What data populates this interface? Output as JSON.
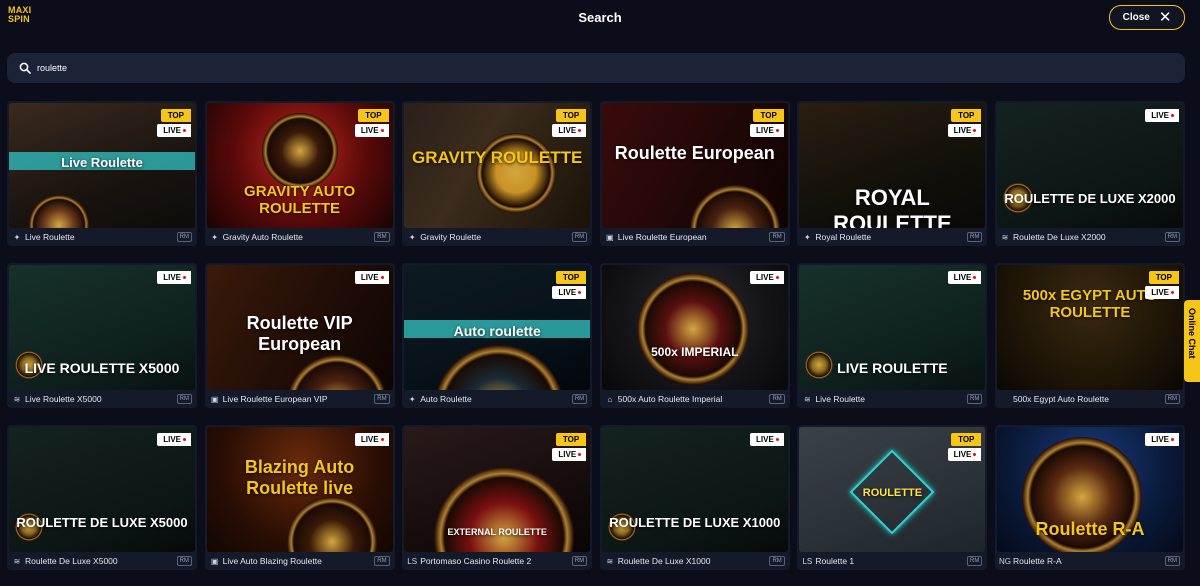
{
  "header": {
    "logo": "MAXI SPIN",
    "title": "Search",
    "close_label": "Close"
  },
  "search": {
    "value": "roulette",
    "icon": "search-icon"
  },
  "chat": {
    "label": "Online Chat"
  },
  "colors": {
    "accent": "#f5c518",
    "background": "#0b0e1a",
    "card": "#151a2b"
  },
  "games": [
    {
      "name": "Live Roulette",
      "thumb_title": "Live Roulette",
      "top": true,
      "live": true,
      "provider_icon": "star-icon",
      "tag": "RM"
    },
    {
      "name": "Gravity Auto Roulette",
      "thumb_title": "GRAVITY AUTO ROULETTE",
      "top": true,
      "live": true,
      "provider_icon": "star-icon",
      "tag": "RM"
    },
    {
      "name": "Gravity Roulette",
      "thumb_title": "GRAVITY ROULETTE",
      "top": true,
      "live": true,
      "provider_icon": "star-icon",
      "tag": "RM"
    },
    {
      "name": "Live Roulette European",
      "thumb_title": "Roulette European",
      "top": true,
      "live": true,
      "provider_icon": "p-icon",
      "tag": "RM"
    },
    {
      "name": "Royal Roulette",
      "thumb_title": "ROYAL ROULETTE",
      "top": true,
      "live": true,
      "provider_icon": "star-icon",
      "tag": "RM"
    },
    {
      "name": "Roulette De Luxe X2000",
      "thumb_title": "ROULETTE DE LUXE X2000",
      "top": false,
      "live": true,
      "provider_icon": "wave-icon",
      "tag": "RM"
    },
    {
      "name": "Live Roulette X5000",
      "thumb_title": "LIVE ROULETTE X5000",
      "top": false,
      "live": true,
      "provider_icon": "wave-icon",
      "tag": "RM"
    },
    {
      "name": "Live Roulette European VIP",
      "thumb_title": "Roulette VIP European",
      "top": false,
      "live": true,
      "provider_icon": "p-icon",
      "tag": "RM"
    },
    {
      "name": "Auto Roulette",
      "thumb_title": "Auto roulette",
      "top": true,
      "live": true,
      "provider_icon": "star-icon",
      "tag": "RM"
    },
    {
      "name": "500x Auto Roulette Imperial",
      "thumb_title": "500x IMPERIAL",
      "top": false,
      "live": true,
      "provider_icon": "bank-icon",
      "tag": "RM"
    },
    {
      "name": "Live Roulette",
      "thumb_title": "LIVE ROULETTE",
      "top": false,
      "live": true,
      "provider_icon": "wave-icon",
      "tag": "RM"
    },
    {
      "name": "500x Egypt Auto Roulette",
      "thumb_title": "500x EGYPT AUTO ROULETTE",
      "top": true,
      "live": true,
      "provider_icon": "",
      "tag": "RM"
    },
    {
      "name": "Roulette De Luxe X5000",
      "thumb_title": "ROULETTE DE LUXE X5000",
      "top": false,
      "live": true,
      "provider_icon": "wave-icon",
      "tag": "RM"
    },
    {
      "name": "Live Auto Blazing Roulette",
      "thumb_title": "Blazing Auto Roulette live",
      "top": false,
      "live": true,
      "provider_icon": "p-icon",
      "tag": "RM"
    },
    {
      "name": "Portomaso Casino Roulette 2",
      "thumb_title": "EXTERNAL ROULETTE",
      "top": true,
      "live": true,
      "provider_icon": "ls-icon",
      "tag": "RM"
    },
    {
      "name": "Roulette De Luxe X1000",
      "thumb_title": "ROULETTE DE LUXE X1000",
      "top": false,
      "live": true,
      "provider_icon": "wave-icon",
      "tag": "RM"
    },
    {
      "name": "Roulette 1",
      "thumb_title": "ROULETTE",
      "top": true,
      "live": true,
      "provider_icon": "ls-icon",
      "tag": "RM"
    },
    {
      "name": "Roulette R-A",
      "thumb_title": "Roulette R-A",
      "top": false,
      "live": true,
      "provider_icon": "ng-icon",
      "tag": "RM"
    }
  ],
  "badges": {
    "top": "TOP",
    "live": "LIVE"
  }
}
